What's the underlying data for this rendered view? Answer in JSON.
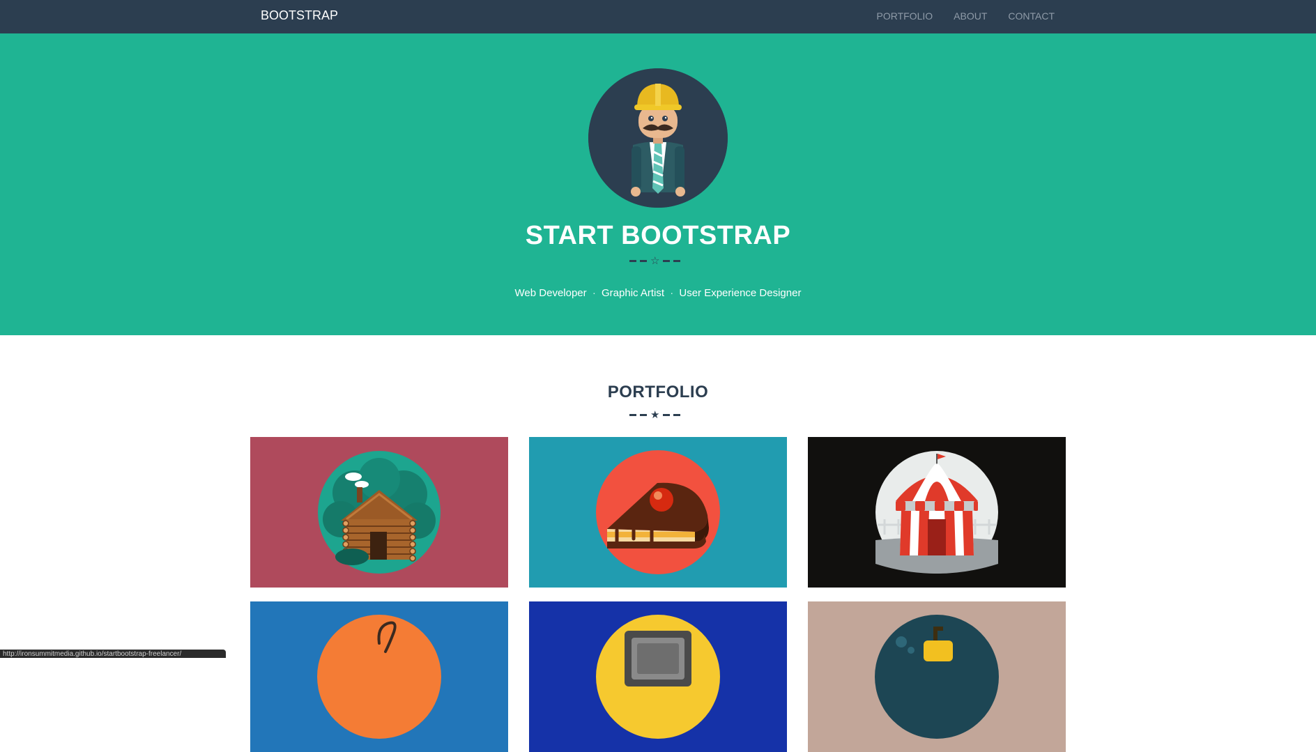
{
  "navbar": {
    "brand": "BOOTSTRAP",
    "links": [
      {
        "label": "PORTFOLIO"
      },
      {
        "label": "ABOUT"
      },
      {
        "label": "CONTACT"
      }
    ]
  },
  "hero": {
    "avatar_icon": "construction-worker-avatar",
    "title": "START BOOTSTRAP",
    "skills": [
      "Web Developer",
      "Graphic Artist",
      "User Experience Designer"
    ],
    "skill_separator": "·"
  },
  "portfolio": {
    "heading": "PORTFOLIO",
    "items": [
      {
        "icon": "log-cabin-icon",
        "bg": "#af4a5c"
      },
      {
        "icon": "cake-slice-icon",
        "bg": "#219cb0"
      },
      {
        "icon": "circus-tent-icon",
        "bg": "#11100e"
      },
      {
        "icon": "game-controller-icon",
        "bg": "#2276b9"
      },
      {
        "icon": "safe-icon",
        "bg": "#1532a8"
      },
      {
        "icon": "submarine-icon",
        "bg": "#c2a699"
      }
    ]
  },
  "status_bar": {
    "url": "http://ironsummitmedia.github.io/startbootstrap-freelancer/"
  },
  "colors": {
    "navbar": "#2c3e50",
    "hero": "#1fb493",
    "text_dark": "#2c3e50"
  }
}
